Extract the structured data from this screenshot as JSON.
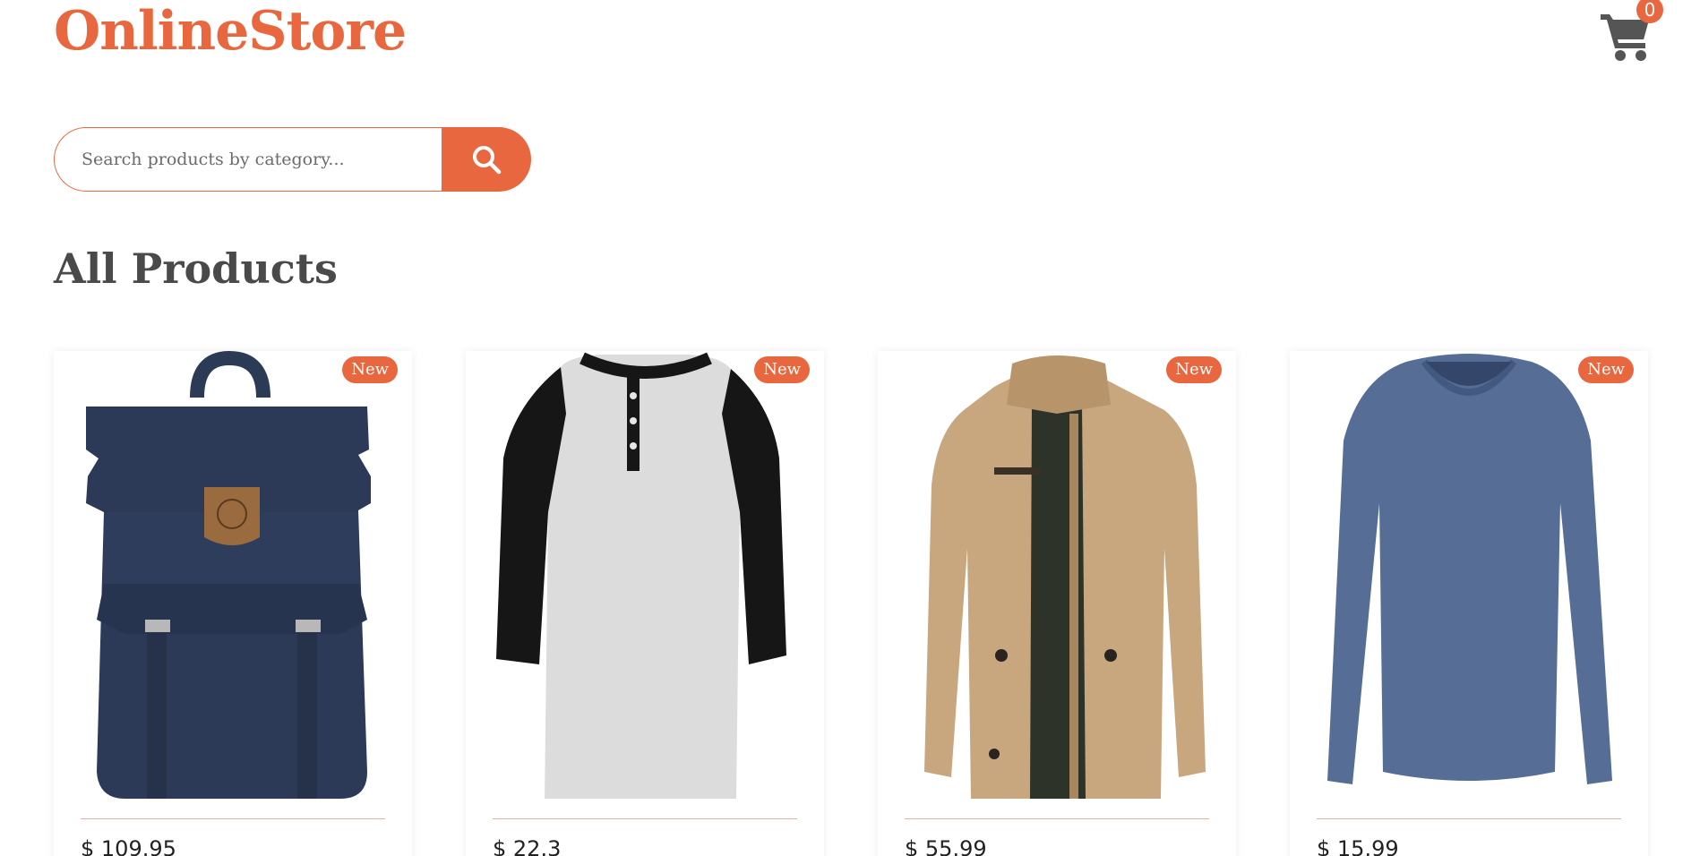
{
  "brand": {
    "name": "OnlineStore",
    "accent": "#e8673e"
  },
  "header": {
    "cart_icon": "shopping-cart-icon",
    "cart_count": "0"
  },
  "search": {
    "placeholder": "Search products by category...",
    "value": "",
    "button_icon": "search-icon"
  },
  "main": {
    "title": "All Products",
    "products": [
      {
        "badge": "New",
        "price": "$ 109.95",
        "image": "navy-backpack"
      },
      {
        "badge": "New",
        "price": "$ 22.3",
        "image": "raglan-henley-shirt"
      },
      {
        "badge": "New",
        "price": "$ 55.99",
        "image": "khaki-cotton-jacket"
      },
      {
        "badge": "New",
        "price": "$ 15.99",
        "image": "blue-long-sleeve-shirt"
      }
    ]
  }
}
